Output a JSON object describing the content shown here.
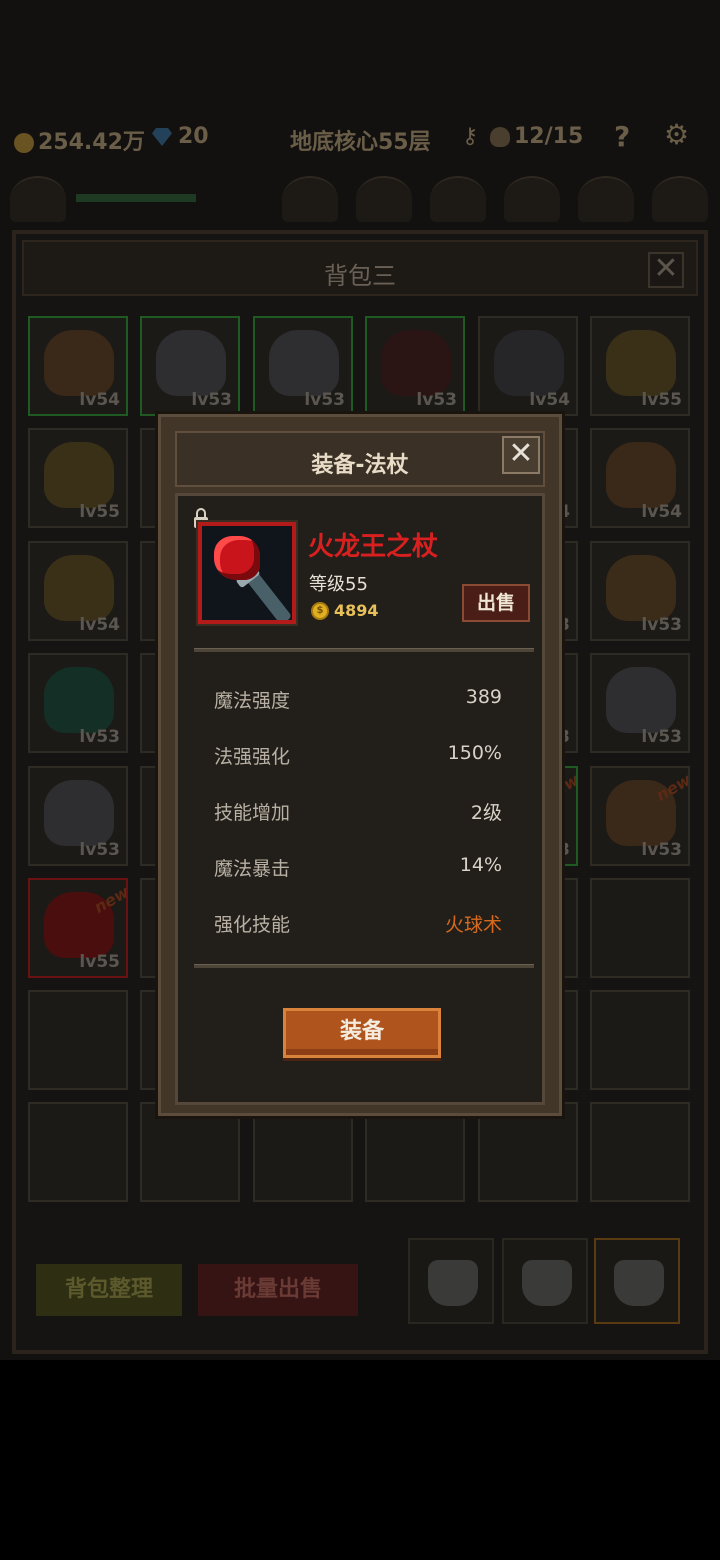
{
  "topbar": {
    "gold": "254.42万",
    "gems": "20",
    "dungeon": "地底核心55层",
    "skulls": "12/15",
    "help": "?"
  },
  "panel": {
    "title": "背包三",
    "close": "✕"
  },
  "slots": [
    {
      "lv": "lv54",
      "art": "wood",
      "frame": "green",
      "isNew": false
    },
    {
      "lv": "lv53",
      "art": "armor",
      "frame": "green",
      "isNew": false
    },
    {
      "lv": "lv53",
      "art": "armor",
      "frame": "green",
      "isNew": false
    },
    {
      "lv": "lv53",
      "art": "helm",
      "frame": "green",
      "isNew": false
    },
    {
      "lv": "lv54",
      "art": "gun",
      "frame": "plain",
      "isNew": false
    },
    {
      "lv": "lv55",
      "art": "gold",
      "frame": "plain",
      "isNew": false
    },
    {
      "lv": "lv55",
      "art": "gold",
      "frame": "plain",
      "isNew": false
    },
    {
      "lv": "",
      "art": "armor",
      "frame": "plain",
      "isNew": false
    },
    {
      "lv": "",
      "art": "",
      "frame": "plain",
      "isNew": false
    },
    {
      "lv": "",
      "art": "",
      "frame": "plain",
      "isNew": false
    },
    {
      "lv": "4",
      "art": "",
      "frame": "plain",
      "isNew": false
    },
    {
      "lv": "lv54",
      "art": "wood",
      "frame": "plain",
      "isNew": false
    },
    {
      "lv": "lv54",
      "art": "gold",
      "frame": "plain",
      "isNew": false
    },
    {
      "lv": "",
      "art": "armor",
      "frame": "plain",
      "isNew": false
    },
    {
      "lv": "",
      "art": "",
      "frame": "plain",
      "isNew": false
    },
    {
      "lv": "",
      "art": "",
      "frame": "plain",
      "isNew": false
    },
    {
      "lv": "3",
      "art": "",
      "frame": "plain",
      "isNew": false
    },
    {
      "lv": "lv53",
      "art": "bow",
      "frame": "plain",
      "isNew": false
    },
    {
      "lv": "lv53",
      "art": "blade",
      "frame": "plain",
      "isNew": false
    },
    {
      "lv": "",
      "art": "wood",
      "frame": "plain",
      "isNew": false
    },
    {
      "lv": "",
      "art": "",
      "frame": "plain",
      "isNew": false
    },
    {
      "lv": "",
      "art": "",
      "frame": "plain",
      "isNew": false
    },
    {
      "lv": "3",
      "art": "",
      "frame": "plain",
      "isNew": false
    },
    {
      "lv": "lv53",
      "art": "armor",
      "frame": "plain",
      "isNew": false
    },
    {
      "lv": "lv53",
      "art": "armor",
      "frame": "plain",
      "isNew": false
    },
    {
      "lv": "",
      "art": "",
      "frame": "plain",
      "isNew": false
    },
    {
      "lv": "",
      "art": "",
      "frame": "plain",
      "isNew": false
    },
    {
      "lv": "",
      "art": "",
      "frame": "plain",
      "isNew": false
    },
    {
      "lv": "3",
      "art": "",
      "frame": "green",
      "isNew": true
    },
    {
      "lv": "lv53",
      "art": "wood",
      "frame": "plain",
      "isNew": true
    },
    {
      "lv": "lv55",
      "art": "staff",
      "frame": "red",
      "isNew": true
    },
    {
      "lv": "",
      "art": "",
      "frame": "plain",
      "isNew": false
    },
    {
      "lv": "",
      "art": "",
      "frame": "plain",
      "isNew": false
    },
    {
      "lv": "",
      "art": "",
      "frame": "plain",
      "isNew": false
    },
    {
      "lv": "",
      "art": "",
      "frame": "plain",
      "isNew": false
    },
    {
      "lv": "",
      "art": "",
      "frame": "plain",
      "isNew": false
    },
    {
      "lv": "",
      "art": "",
      "frame": "plain",
      "isNew": false
    },
    {
      "lv": "",
      "art": "",
      "frame": "plain",
      "isNew": false
    },
    {
      "lv": "",
      "art": "",
      "frame": "plain",
      "isNew": false
    },
    {
      "lv": "",
      "art": "",
      "frame": "plain",
      "isNew": false
    },
    {
      "lv": "",
      "art": "",
      "frame": "plain",
      "isNew": false
    },
    {
      "lv": "",
      "art": "",
      "frame": "plain",
      "isNew": false
    },
    {
      "lv": "",
      "art": "",
      "frame": "plain",
      "isNew": false
    },
    {
      "lv": "",
      "art": "",
      "frame": "plain",
      "isNew": false
    },
    {
      "lv": "",
      "art": "",
      "frame": "plain",
      "isNew": false
    },
    {
      "lv": "",
      "art": "",
      "frame": "plain",
      "isNew": false
    },
    {
      "lv": "",
      "art": "",
      "frame": "plain",
      "isNew": false
    },
    {
      "lv": "",
      "art": "",
      "frame": "plain",
      "isNew": false
    }
  ],
  "bottom": {
    "sort_label": "背包整理",
    "bulk_sell_label": "批量出售",
    "bag_tabs": [
      "bag-1",
      "bag-2",
      "bag-3"
    ],
    "active_tab": 2
  },
  "modal": {
    "title": "装备-法杖",
    "close": "✕",
    "item": {
      "name": "火龙王之杖",
      "level": "等级55",
      "price": "4894",
      "coin_symbol": "$",
      "sell_label": "出售",
      "locked": false
    },
    "stats": [
      {
        "label": "魔法强度",
        "value": "389"
      },
      {
        "label": "法强强化",
        "value": "150%"
      },
      {
        "label": "技能增加",
        "value": "2级"
      },
      {
        "label": "魔法暴击",
        "value": "14%"
      },
      {
        "label": "强化技能",
        "value": "火球术",
        "highlight": true
      }
    ],
    "equip_label": "装备"
  },
  "colors": {
    "item_name": "#d92020",
    "price": "#e8c15a",
    "skill": "#d86a1e",
    "equip_button": "#b0541e",
    "sell_button": "#4a1e16"
  }
}
